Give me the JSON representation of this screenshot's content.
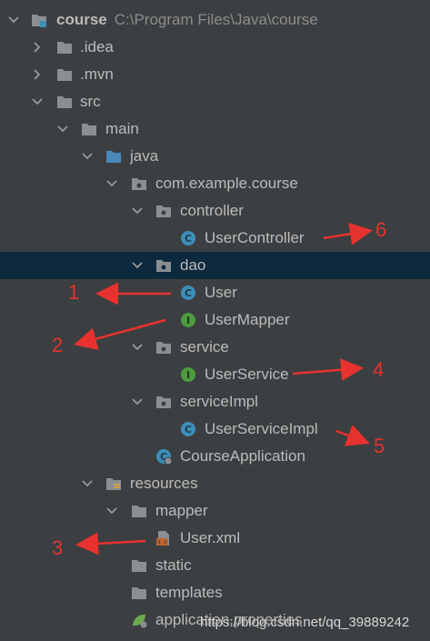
{
  "tree": {
    "root_label": "course",
    "root_path": "C:\\Program Files\\Java\\course",
    "idea": ".idea",
    "mvn": ".mvn",
    "src": "src",
    "main": "main",
    "java": "java",
    "package": "com.example.course",
    "controller": "controller",
    "user_controller": "UserController",
    "dao": "dao",
    "user": "User",
    "user_mapper": "UserMapper",
    "service": "service",
    "user_service": "UserService",
    "service_impl": "serviceImpl",
    "user_service_impl": "UserServiceImpl",
    "course_application": "CourseApplication",
    "resources": "resources",
    "mapper": "mapper",
    "user_xml": "User.xml",
    "static": "static",
    "templates": "templates",
    "application_properties": "application.properties"
  },
  "annotations": {
    "n1": "1",
    "n2": "2",
    "n3": "3",
    "n4": "4",
    "n5": "5",
    "n6": "6"
  },
  "watermark": "https://blog.csdn.net/qq_39889242",
  "colors": {
    "background": "#3c3f41",
    "selected_row": "#0d293e",
    "class_icon": "#3d8fb8",
    "interface_icon": "#4f9a3f",
    "annotation": "#e8322f"
  }
}
